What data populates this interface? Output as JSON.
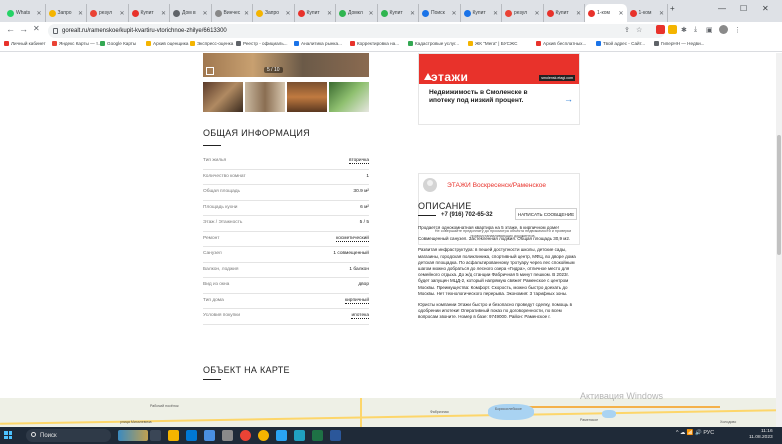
{
  "browser": {
    "tabs": [
      {
        "label": "Whats",
        "color": "#25d366"
      },
      {
        "label": "Запро",
        "color": "#f4b400"
      },
      {
        "label": "резул",
        "color": "#ea4335"
      },
      {
        "label": "Купит",
        "color": "#e8322b"
      },
      {
        "label": "Дом в",
        "color": "#5f6368"
      },
      {
        "label": "Винчес",
        "color": "#888888"
      },
      {
        "label": "Запро",
        "color": "#f4b400"
      },
      {
        "label": "Купит",
        "color": "#e8322b"
      },
      {
        "label": "Домкл",
        "color": "#2fb550"
      },
      {
        "label": "Купит",
        "color": "#2fb550"
      },
      {
        "label": "Поиск",
        "color": "#1a73e8"
      },
      {
        "label": "Купит",
        "color": "#1a73e8"
      },
      {
        "label": "резул",
        "color": "#ea4335"
      },
      {
        "label": "Купит",
        "color": "#e8322b"
      },
      {
        "label": "1-ком",
        "color": "#e8322b"
      },
      {
        "label": "1-ком",
        "color": "#e8322b"
      }
    ],
    "new_tab": "+",
    "window_controls": {
      "minimize": "—",
      "maximize": "☐",
      "close": "✕"
    },
    "nav": {
      "back": "←",
      "forward": "→",
      "close": "✕"
    },
    "url": "gorealt.ru/ramenskoe/kupit-kvartiru-vtorichnoe-zhilye/6613300",
    "bookmarks": [
      {
        "label": "Личный кабинет",
        "color": "#e8322b"
      },
      {
        "label": "Яндекс Карты — т...",
        "color": "#ea4335"
      },
      {
        "label": "Google Карты",
        "color": "#34a853"
      },
      {
        "label": "Архив оценщика",
        "color": "#f4b400"
      },
      {
        "label": "Экспресс-оценка",
        "color": "#f4b400"
      },
      {
        "label": "Реестр - официаль...",
        "color": "#5f6368"
      },
      {
        "label": "Аналитика рынка...",
        "color": "#1a73e8"
      },
      {
        "label": "Корректировка на...",
        "color": "#e8322b"
      },
      {
        "label": "Кадастровые услуг...",
        "color": "#34a853"
      },
      {
        "label": "ЖК \"Мега\" | БУСЖС",
        "color": "#f4b400"
      },
      {
        "label": "Архив бесплатных...",
        "color": "#e8322b"
      },
      {
        "label": "Твой адрес - Сайт...",
        "color": "#1a73e8"
      },
      {
        "label": "ГиперНН — Недви...",
        "color": "#5f6368"
      }
    ]
  },
  "listing": {
    "photo_counter": "5 / 10",
    "section_title": "ОБЩАЯ ИНФОРМАЦИЯ",
    "specs": [
      {
        "label": "Тип жилья",
        "value": "вторичка",
        "link": true
      },
      {
        "label": "Количество комнат",
        "value": "1",
        "link": false
      },
      {
        "label": "Общая площадь",
        "value": "30.9 м²",
        "link": false
      },
      {
        "label": "Площадь кухни",
        "value": "6 м²",
        "link": false
      },
      {
        "label": "Этаж / Этажность",
        "value": "5 / 5",
        "link": false
      },
      {
        "label": "Ремонт",
        "value": "косметический",
        "link": true
      },
      {
        "label": "Санузел",
        "value": "1 совмещенный",
        "link": false
      },
      {
        "label": "Балкон, лоджия",
        "value": "1 балкон",
        "link": false
      },
      {
        "label": "Вид из окна",
        "value": "двор",
        "link": false
      },
      {
        "label": "Тип дома",
        "value": "кирпичный",
        "link": true
      },
      {
        "label": "Условия покупки",
        "value": "ипотека",
        "link": true
      }
    ],
    "map_title": "ОБЪЕКТ НА КАРТЕ"
  },
  "ad": {
    "logo": "этажи",
    "site": "smolensk.etagi.com",
    "text": "Недвижимость в Смоленске в ипотеку под низкий процент.",
    "arrow": "→"
  },
  "agent": {
    "name": "ЭТАЖИ Воскресенск/Раменское",
    "phone": "+7 (916) 702-65-32",
    "message_button": "НАПИСАТЬ СООБЩЕНИЕ",
    "note": "Не совершайте предоплату до просмотра объекта недвижимости и проверки правоустанавливающих документов."
  },
  "description": {
    "title": "ОПИСАНИЕ",
    "paragraphs": [
      "Продается однокомнатная квартира на 5 этаже, в кирпичном доме!",
      "Совмещенный санузел. Застекленная лоджия. Общая площадь 30,9 м2.",
      "Развитая инфраструктура: в пешей доступности школы, детские сады, магазины, городская поликлиника, спортивный центр, МФЦ, во дворе дома детская площадка. По асфальтированному тротуару через лес спокойным шагом можно добраться до лесного озера «Гидра», отличное место для семейного отдыха. До ж/д станции Фабричная 5 минут пешком. В 2023г. будет запущен МЦД-2, который напрямую свяжет Раменское с центром Москвы. Преимущества: Комфорт. Скорость, можно быстро доехать до Москвы. Нет технологического перерыва. Экономия: 3 тарифных зоны.",
      "Юристы компании Этажи быстро и безопасно проведут сделку, помощь в одобрении ипотеки! Оперативный показ по договоренности, по всем вопросам звоните. Номер в базе: 9749000. Район: Раменское г."
    ]
  },
  "map": {
    "labels": [
      "Рабочий посёлок",
      "улица Михалевича",
      "Фабричная",
      "Борисоглебское",
      "Раменское",
      "Холодово"
    ]
  },
  "watermark": "Активация Windows",
  "taskbar": {
    "search_placeholder": "Поиск",
    "tray_text": "^ ☁ 📶 🔊 РУС",
    "time": "11:16",
    "date": "11.08.2023"
  }
}
